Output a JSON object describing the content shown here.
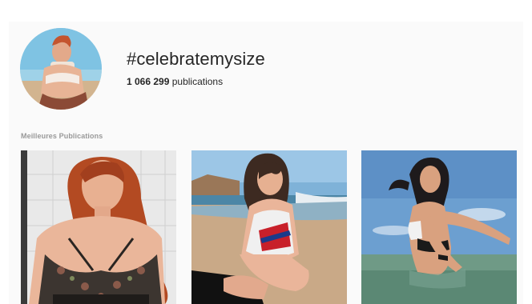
{
  "hashtag": {
    "title": "#celebratemysize",
    "publications_count": "1 066 299",
    "publications_label": "publications"
  },
  "top_posts": {
    "section_label": "Meilleures Publications",
    "posts": [
      {
        "icon": "photo-woman-floral-swimsuit"
      },
      {
        "icon": "photo-woman-beach-swimsuit"
      },
      {
        "icon": "photo-woman-sea-swimsuit"
      }
    ]
  }
}
